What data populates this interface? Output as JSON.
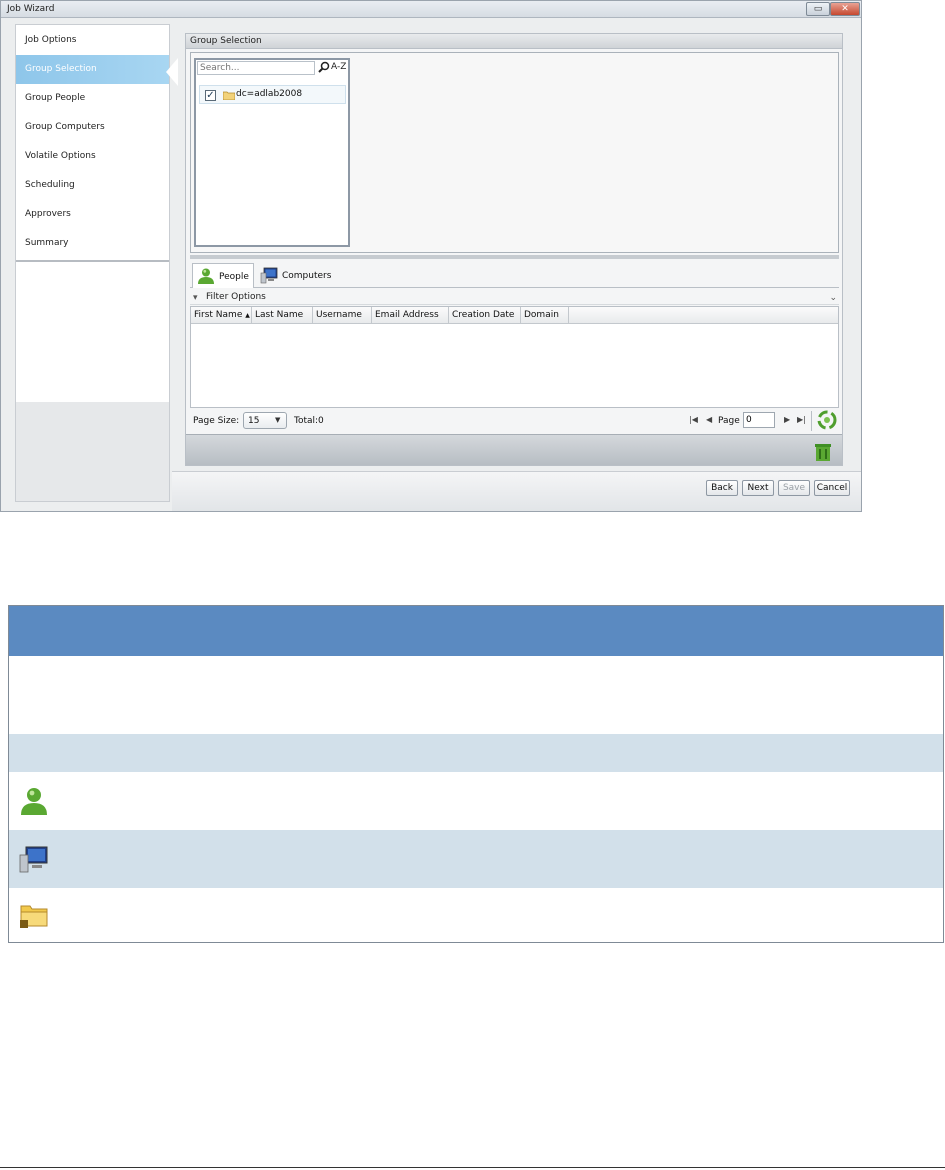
{
  "window": {
    "title": "Job Wizard"
  },
  "nav": {
    "items": [
      {
        "label": "Job Options"
      },
      {
        "label": "Group Selection"
      },
      {
        "label": "Group People"
      },
      {
        "label": "Group Computers"
      },
      {
        "label": "Volatile Options"
      },
      {
        "label": "Scheduling"
      },
      {
        "label": "Approvers"
      },
      {
        "label": "Summary"
      }
    ],
    "selected": "Group Selection"
  },
  "group_selection": {
    "header": "Group Selection",
    "search_placeholder": "Search...",
    "sort_label": "A-Z",
    "tree": [
      {
        "label": "dc=adlab2008",
        "checked": true
      }
    ]
  },
  "tabs": [
    {
      "label": "People",
      "icon": "person-icon",
      "active": true
    },
    {
      "label": "Computers",
      "icon": "computer-icon",
      "active": false
    }
  ],
  "filter": {
    "label": "Filter Options"
  },
  "grid": {
    "columns": [
      "First Name",
      "Last Name",
      "Username",
      "Email Address",
      "Creation Date",
      "Domain"
    ],
    "sort_indicator": "▲",
    "rows": []
  },
  "pager": {
    "page_size_label": "Page Size:",
    "page_size_value": "15",
    "total_label": "Total:0",
    "page_label": "Page",
    "page_value": "0"
  },
  "buttons": {
    "back": "Back",
    "next": "Next",
    "save": "Save",
    "cancel": "Cancel"
  },
  "legend": {
    "icons": [
      "person-icon",
      "computer-icon",
      "folder-icon"
    ]
  },
  "colors": {
    "nav_selected": "#8ec6ea",
    "legend_header": "#5b8ac1",
    "legend_alt_row": "#d2e0ea",
    "people_green": "#5aa832"
  }
}
